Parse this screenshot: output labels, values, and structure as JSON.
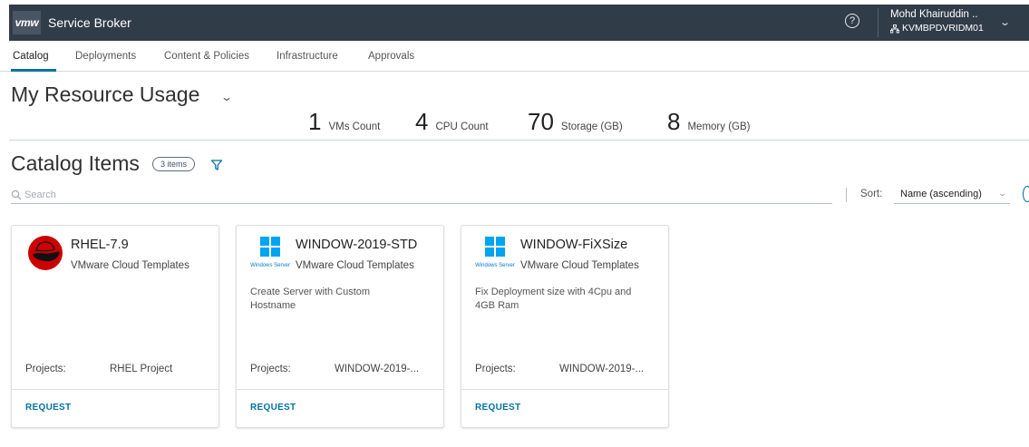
{
  "header": {
    "logo": "vmw",
    "app_title": "Service Broker",
    "help_glyph": "?",
    "user_name": "Mohd Khairuddin ..",
    "tenant": "KVMBPDVRIDM01",
    "colors": {
      "bar": "#313c49",
      "accent": "#0072a3"
    }
  },
  "tabs": [
    {
      "label": "Catalog",
      "active": true
    },
    {
      "label": "Deployments",
      "active": false
    },
    {
      "label": "Content & Policies",
      "active": false
    },
    {
      "label": "Infrastructure",
      "active": false
    },
    {
      "label": "Approvals",
      "active": false
    }
  ],
  "resource_usage": {
    "title": "My Resource Usage",
    "stats": [
      {
        "value": "1",
        "label": "VMs Count"
      },
      {
        "value": "4",
        "label": "CPU Count"
      },
      {
        "value": "70",
        "label": "Storage (GB)"
      },
      {
        "value": "8",
        "label": "Memory (GB)"
      }
    ]
  },
  "catalog": {
    "title": "Catalog Items",
    "count_badge": "3 items",
    "search_placeholder": "Search",
    "sort_label": "Sort:",
    "sort_value": "Name (ascending)",
    "items": [
      {
        "icon": "redhat-icon",
        "title": "RHEL-7.9",
        "type": "VMware Cloud Templates",
        "description": "",
        "projects_label": "Projects:",
        "projects_value": "RHEL Project",
        "action": "REQUEST"
      },
      {
        "icon": "windows-server-icon",
        "icon_caption": "Windows Server",
        "title": "WINDOW-2019-STD",
        "type": "VMware Cloud Templates",
        "description": "Create Server with Custom Hostname",
        "projects_label": "Projects:",
        "projects_value": "WINDOW-2019-...",
        "action": "REQUEST"
      },
      {
        "icon": "windows-server-icon",
        "icon_caption": "Windows Server",
        "title": "WINDOW-FiXSize",
        "type": "VMware Cloud Templates",
        "description": "Fix Deployment size with 4Cpu and 4GB Ram",
        "projects_label": "Projects:",
        "projects_value": "WINDOW-2019-...",
        "action": "REQUEST"
      }
    ]
  }
}
